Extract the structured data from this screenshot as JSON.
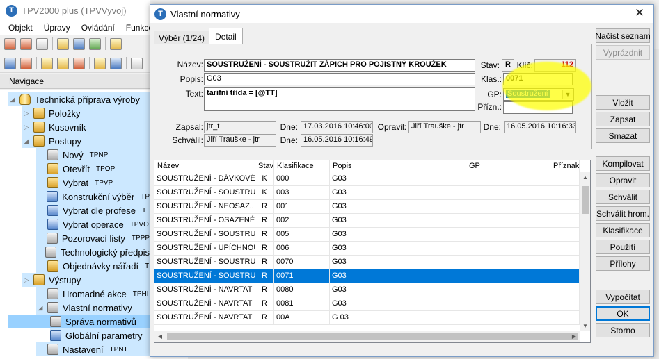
{
  "main_window": {
    "title": "TPV2000 plus (TPVVyvoj)",
    "logo_letter": "T",
    "menu": [
      "Objekt",
      "Úpravy",
      "Ovládání",
      "Funkce"
    ],
    "nav_header": "Navigace",
    "tree": [
      {
        "label": "Technická příprava výroby",
        "code": "",
        "twisty": "◢",
        "icon": "cylinder-icon"
      },
      {
        "label": "Položky",
        "code": "",
        "twisty": "▷",
        "icon": "cube-icon"
      },
      {
        "label": "Kusovník",
        "code": "",
        "twisty": "▷",
        "icon": "structure-icon"
      },
      {
        "label": "Postupy",
        "code": "",
        "twisty": "◢",
        "icon": "gear-folder-icon"
      },
      {
        "label": "Nový",
        "code": "TPNP",
        "twisty": "",
        "icon": "new-icon"
      },
      {
        "label": "Otevřít",
        "code": "TPOP",
        "twisty": "",
        "icon": "open-icon"
      },
      {
        "label": "Vybrat",
        "code": "TPVP",
        "twisty": "",
        "icon": "select-icon"
      },
      {
        "label": "Konstrukční výběr",
        "code": "TP",
        "twisty": "",
        "icon": "construction-icon"
      },
      {
        "label": "Vybrat dle profese",
        "code": "T",
        "twisty": "",
        "icon": "profession-icon"
      },
      {
        "label": "Vybrat operace",
        "code": "TPVO",
        "twisty": "",
        "icon": "calendar-icon"
      },
      {
        "label": "Pozorovací listy",
        "code": "TPPP",
        "twisty": "",
        "icon": "clock-icon"
      },
      {
        "label": "Technologický předpis",
        "code": "",
        "twisty": "",
        "icon": "document-icon"
      },
      {
        "label": "Objednávky nářadí",
        "code": "T",
        "twisty": "",
        "icon": "tools-icon"
      },
      {
        "label": "Výstupy",
        "code": "",
        "twisty": "▷",
        "icon": "folder-icon"
      },
      {
        "label": "Hromadné akce",
        "code": "TPHI",
        "twisty": "",
        "icon": "bulk-icon"
      },
      {
        "label": "Vlastní normativy",
        "code": "",
        "twisty": "◢",
        "icon": "stopwatch-icon"
      },
      {
        "label": "Správa normativů",
        "code": "",
        "twisty": "",
        "icon": "stopwatch-icon"
      },
      {
        "label": "Globální parametry",
        "code": "",
        "twisty": "",
        "icon": "grid-icon"
      },
      {
        "label": "Nastavení",
        "code": "TPNT",
        "twisty": "",
        "icon": "settings-icon"
      }
    ]
  },
  "dialog": {
    "title": "Vlastní normativy",
    "close_glyph": "✕",
    "tabs": [
      "Výběr (1/24)",
      "Detail"
    ],
    "form": {
      "nazev_label": "Název:",
      "nazev_value": "SOUSTRUŽENÍ -  SOUSTRUŽIT ZÁPICH PRO POJISTNÝ KROUŽEK",
      "popis_label": "Popis:",
      "popis_value": "G03",
      "text_label": "Text:",
      "text_value": "tarifní třída = [@TT]",
      "stav_label": "Stav:",
      "stav_value": "R",
      "klic_label": "Klíč:",
      "klic_value": "112",
      "klas_label": "Klas.:",
      "klas_value": "0071",
      "gp_label": "GP:",
      "gp_value": "Soustružení",
      "prizn_label": "Přízn.:",
      "prizn_value": "",
      "zapsal_label": "Zapsal:",
      "zapsal_value": "jtr_t",
      "dne1_label": "Dne:",
      "dne1_value": "17.03.2016 10:46:00",
      "opravil_label": "Opravil:",
      "opravil_value": "Jiří Trauške - jtr",
      "dne2_label": "Dne:",
      "dne2_value": "16.05.2016 10:16:33",
      "schvalil_label": "Schválil:",
      "schvalil_value": "Jiří Trauške - jtr",
      "dne3_label": "Dne:",
      "dne3_value": "16.05.2016 10:16:49"
    },
    "grid": {
      "columns": [
        "Název",
        "Stav",
        "Klasifikace",
        "Popis",
        "GP",
        "Příznak"
      ],
      "rows": [
        [
          "SOUSTRUŽENÍ - DÁVKOVÉ...",
          "K",
          "000",
          "G03",
          "",
          ""
        ],
        [
          "SOUSTRUŽENÍ - SOUSTRU...",
          "K",
          "003",
          "G03",
          "",
          ""
        ],
        [
          "SOUSTRUŽENÍ  -  NEOSAZ...",
          "R",
          "001",
          "G03",
          "",
          ""
        ],
        [
          "SOUSTRUŽENÍ -  OSAZENÉ...",
          "R",
          "002",
          "G03",
          "",
          ""
        ],
        [
          "SOUSTRUŽENÍ - SOUSTRU...",
          "R",
          "005",
          "G03",
          "",
          ""
        ],
        [
          "SOUSTRUŽENÍ - UPÍCHNOUT",
          "R",
          "006",
          "G03",
          "",
          ""
        ],
        [
          "SOUSTRUŽENÍ -  SOUSTRU...",
          "R",
          "0070",
          "G03",
          "",
          ""
        ],
        [
          "SOUSTRUŽENÍ -  SOUSTRU...",
          "R",
          "0071",
          "G03",
          "",
          ""
        ],
        [
          "SOUSTRUŽENÍ  -  NAVRTAT ...",
          "R",
          "0080",
          "G03",
          "",
          ""
        ],
        [
          "SOUSTRUŽENÍ - NAVRTAT ,...",
          "R",
          "0081",
          "G03",
          "",
          ""
        ],
        [
          "SOUSTRUŽENÍ - NAVRTAT ,...",
          "R",
          "00A",
          "G 03",
          "",
          ""
        ]
      ],
      "selected_row": 7
    },
    "buttons": {
      "nacist_seznam": "Načíst seznam",
      "vyprazdnit": "Vyprázdnit",
      "vlozit": "Vložit",
      "zapsat": "Zapsat",
      "smazat": "Smazat",
      "kompilovat": "Kompilovat",
      "opravit": "Opravit",
      "schvalit": "Schválit",
      "schvalit_hrom": "Schválit hrom.",
      "klasifikace": "Klasifikace",
      "pouziti": "Použití",
      "prilohy": "Přílohy",
      "vypocitat": "Vypočítat",
      "ok": "OK",
      "storno": "Storno"
    }
  },
  "colors": {
    "selection": "#0078d7",
    "tree_selection": "#99d1ff",
    "tree_highlight": "#cce8ff",
    "annotation_highlight": "#ffff00",
    "klic_value": "#cc0000"
  }
}
